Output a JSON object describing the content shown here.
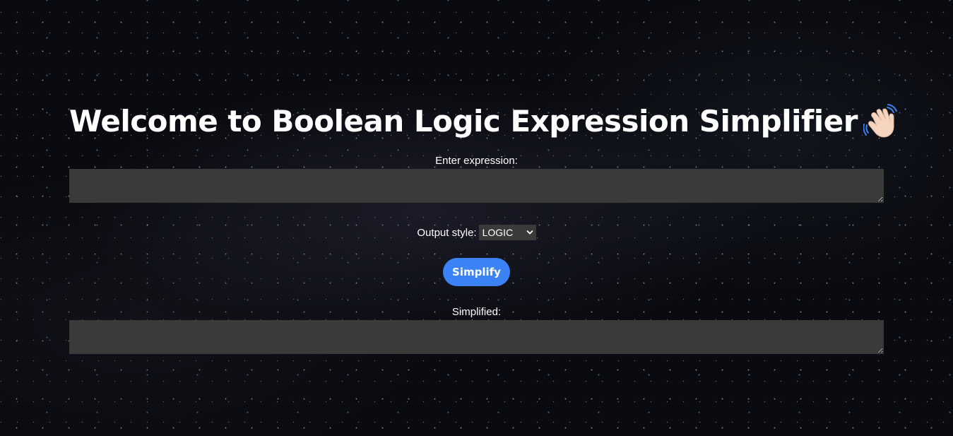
{
  "header": {
    "title": "Welcome to Boolean Logic Expression Simplifier",
    "title_emoji_icon": "waving-hand-icon"
  },
  "input": {
    "label": "Enter expression:",
    "value": ""
  },
  "output_style": {
    "label": "Output style:",
    "selected": "LOGIC"
  },
  "actions": {
    "simplify_label": "Simplify"
  },
  "output": {
    "label": "Simplified:",
    "value": ""
  },
  "colors": {
    "background": "#0a0b10",
    "field_background": "#3a3a3a",
    "button_accent": "#3b82f6",
    "text": "#ffffff"
  }
}
